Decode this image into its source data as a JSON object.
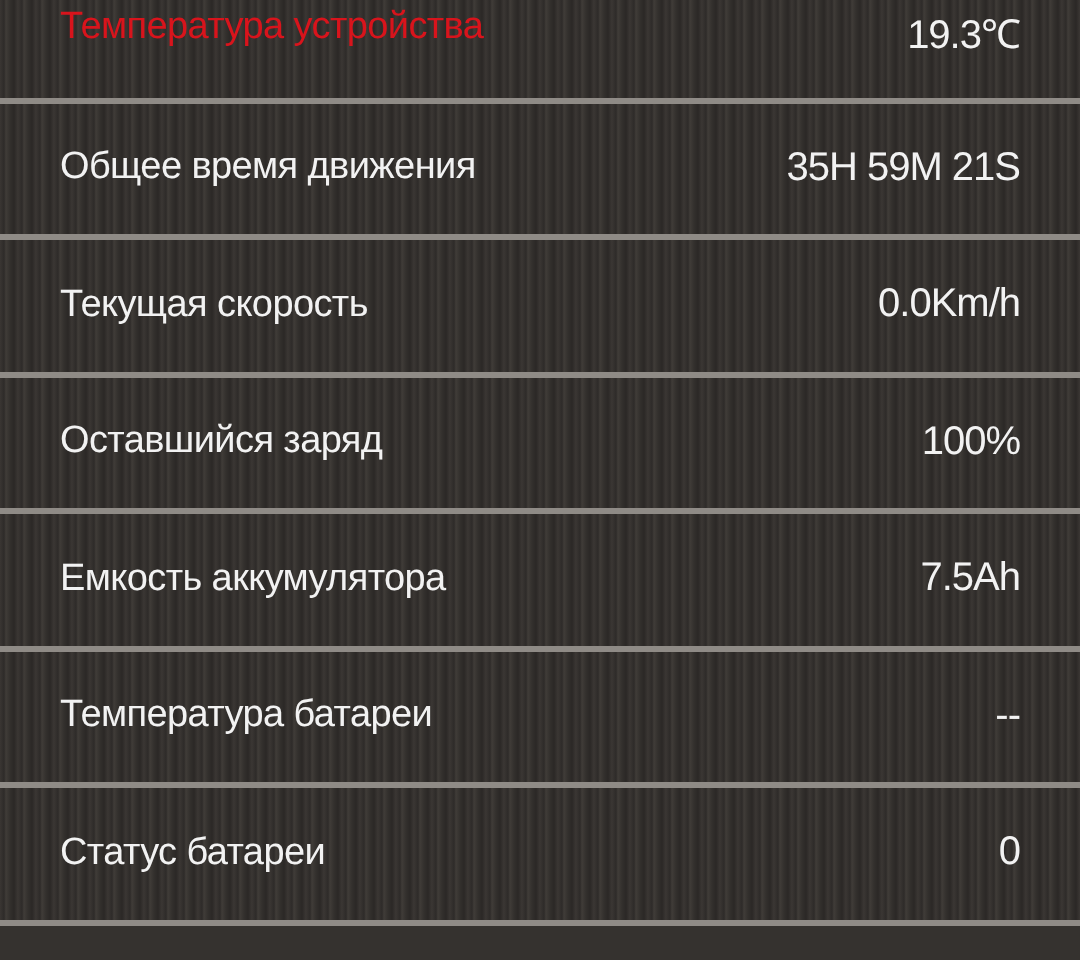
{
  "rows": [
    {
      "label": "Температура устройства",
      "value": "19.3℃",
      "highlight": true
    },
    {
      "label": "Общее время движения",
      "value": "35H 59M 21S",
      "highlight": false
    },
    {
      "label": "Текущая скорость",
      "value": "0.0Km/h",
      "highlight": false
    },
    {
      "label": "Оставшийся заряд",
      "value": "100%",
      "highlight": false
    },
    {
      "label": "Емкость аккумулятора",
      "value": "7.5Ah",
      "highlight": false
    },
    {
      "label": "Температура батареи",
      "value": "--",
      "highlight": false
    },
    {
      "label": "Статус батареи",
      "value": "0",
      "highlight": false
    }
  ]
}
